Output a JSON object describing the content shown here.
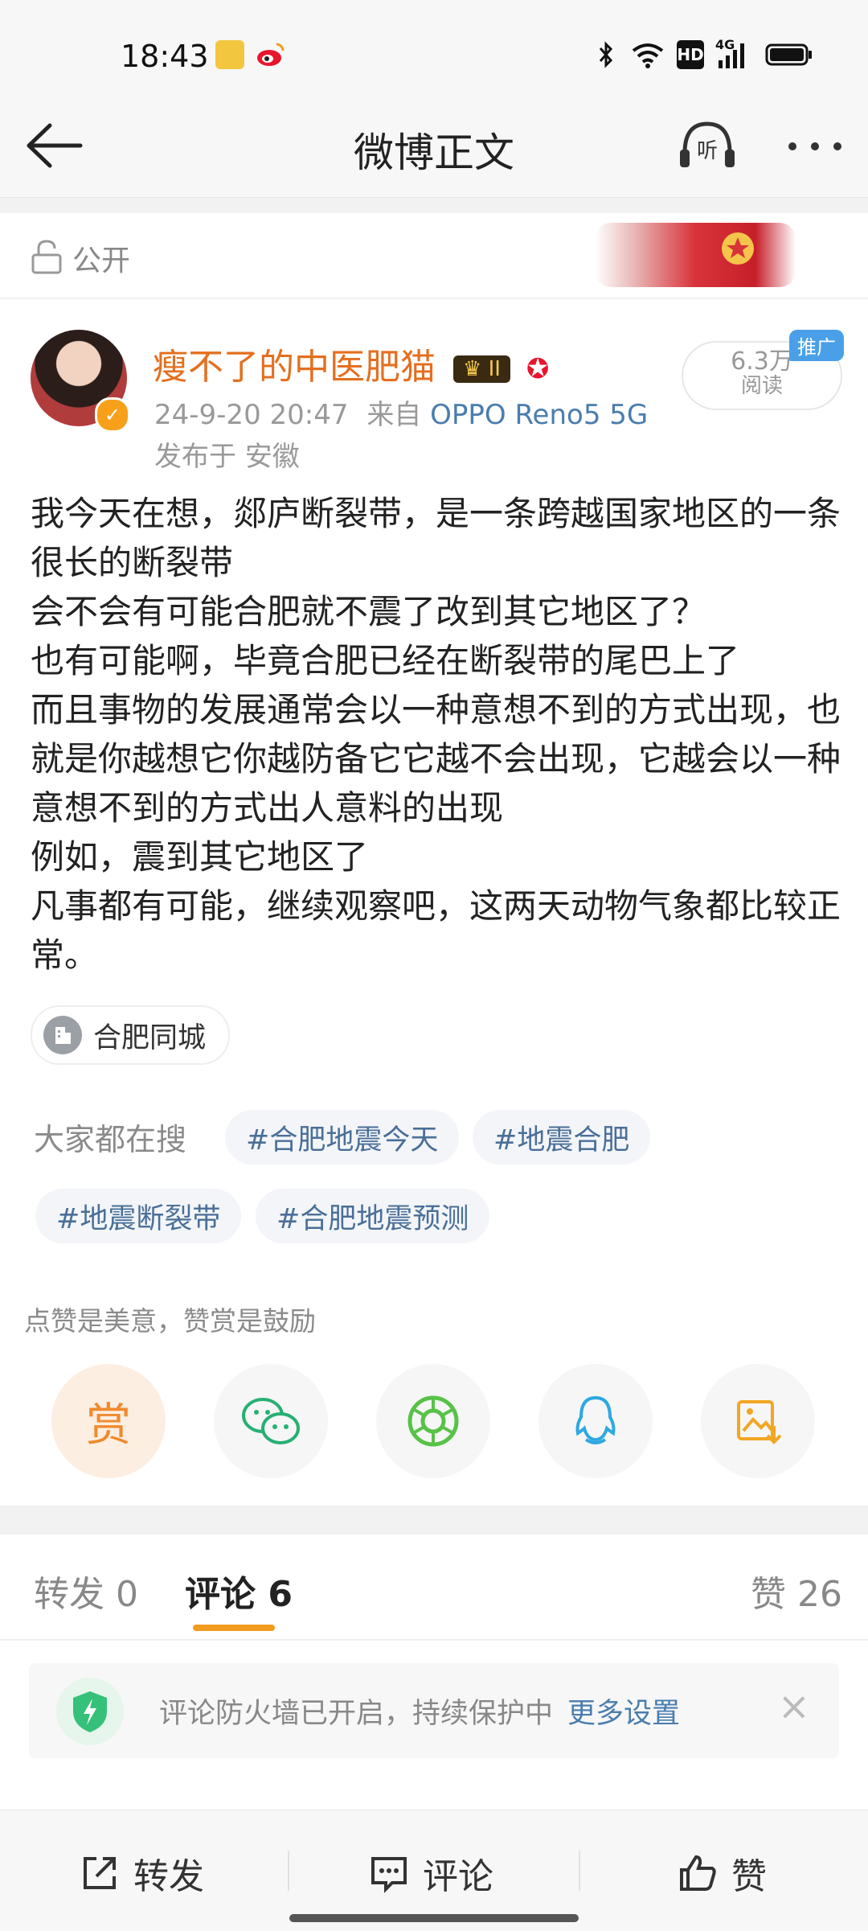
{
  "status_bar": {
    "time": "18:43",
    "network": "4G",
    "hd": "HD"
  },
  "nav": {
    "title": "微博正文"
  },
  "visibility": {
    "label": "公开"
  },
  "post": {
    "author": "瘦不了的中医肥猫",
    "level_badge": "II",
    "timestamp": "24-9-20 20:47",
    "source_prefix": "来自",
    "source_device": "OPPO Reno5 5G",
    "location": "发布于 安徽",
    "reads_count": "6.3万",
    "reads_label": "阅读",
    "promo_tag": "推广",
    "content": "我今天在想，郯庐断裂带，是一条跨越国家地区的一条很长的断裂带\n会不会有可能合肥就不震了改到其它地区了？\n也有可能啊，毕竟合肥已经在断裂带的尾巴上了\n而且事物的发展通常会以一种意想不到的方式出现，也就是你越想它你越防备它它越不会出现，它越会以一种意想不到的方式出人意料的出现\n例如，震到其它地区了\n凡事都有可能，继续观察吧，这两天动物气象都比较正常。",
    "poi": "合肥同城"
  },
  "search": {
    "label": "大家都在搜",
    "tags": [
      "#合肥地震今天",
      "#地震合肥",
      "#地震断裂带",
      "#合肥地震预测"
    ]
  },
  "reward": {
    "hint": "点赞是美意，赞赏是鼓励",
    "reward_label": "赏"
  },
  "share_targets": [
    "reward-icon",
    "wechat-icon",
    "moments-icon",
    "qq-icon",
    "save-image-icon"
  ],
  "tabs": {
    "repost": "转发 0",
    "comments": "评论 6",
    "likes": "赞 26"
  },
  "firewall": {
    "text": "评论防火墙已开启，持续保护中",
    "link": "更多设置"
  },
  "toolbar": {
    "repost": "转发",
    "comment": "评论",
    "like": "赞"
  },
  "colors": {
    "accent": "#f29c1f",
    "username": "#e46f1f",
    "link": "#4a7dae"
  }
}
